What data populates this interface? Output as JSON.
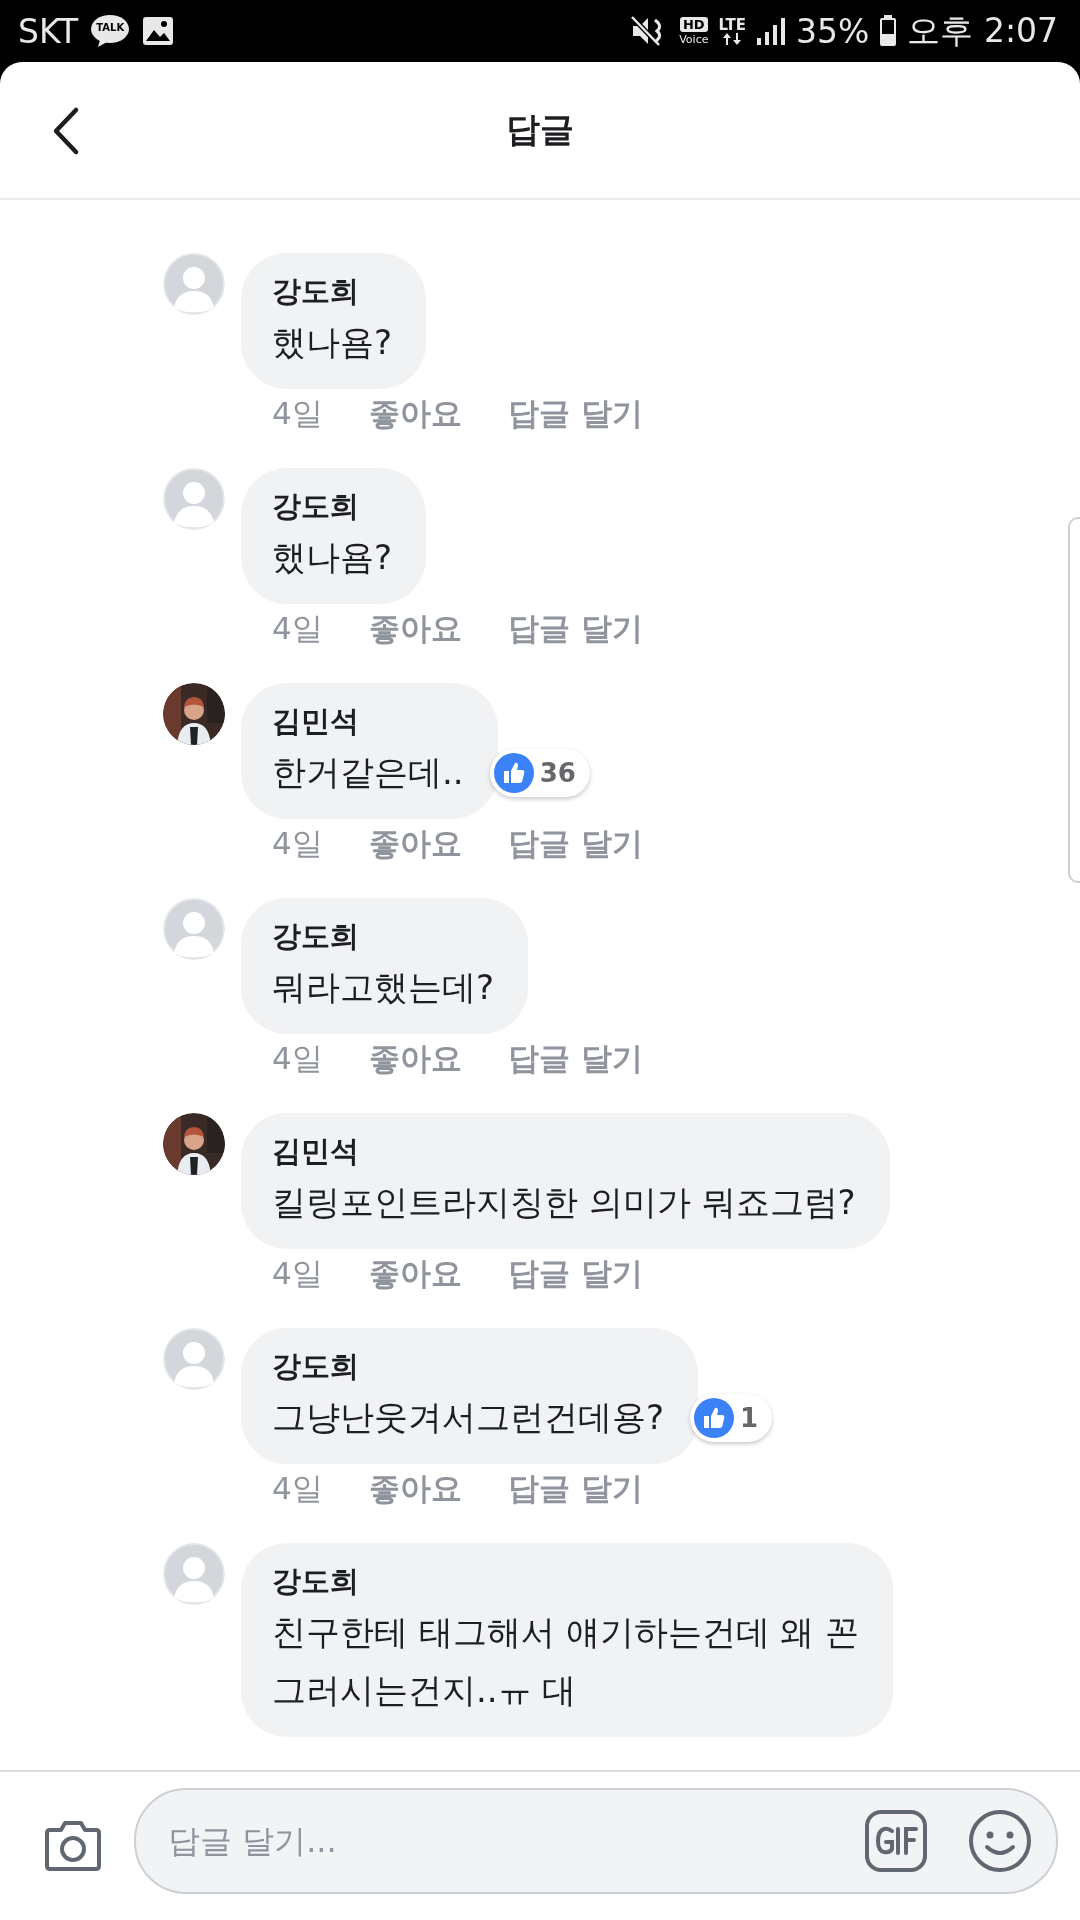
{
  "status_bar": {
    "carrier": "SKT",
    "talk_badge": "TALK",
    "hd_label": "HD",
    "voice_label": "Voice",
    "network": "LTE",
    "battery": "35%",
    "time": "오후 2:07"
  },
  "header": {
    "title": "답글"
  },
  "comments": [
    {
      "kind": "placeholder_avatar",
      "author": "강도희",
      "text": "했나욤?",
      "time": "4일",
      "like": "좋아요",
      "reply": "답글 달기"
    },
    {
      "kind": "placeholder_avatar",
      "author": "강도희",
      "text": "했나욤?",
      "time": "4일",
      "like": "좋아요",
      "reply": "답글 달기"
    },
    {
      "kind": "photo_avatar",
      "author": "김민석",
      "text": "한거같은데..",
      "time": "4일",
      "like": "좋아요",
      "reply": "답글 달기",
      "reaction": {
        "kind": "like",
        "count": "36"
      }
    },
    {
      "kind": "placeholder_avatar",
      "author": "강도희",
      "text": "뭐라고했는데?",
      "time": "4일",
      "like": "좋아요",
      "reply": "답글 달기"
    },
    {
      "kind": "photo_avatar",
      "author": "김민석",
      "text": "킬링포인트라지칭한 의미가 뭐죠그럼?",
      "time": "4일",
      "like": "좋아요",
      "reply": "답글 달기"
    },
    {
      "kind": "placeholder_avatar",
      "author": "강도희",
      "text": "그냥난웃겨서그런건데용?",
      "time": "4일",
      "like": "좋아요",
      "reply": "답글 달기",
      "reaction": {
        "kind": "like",
        "count": "1"
      }
    },
    {
      "kind": "placeholder_avatar",
      "author": "강도희",
      "text": "친구한테 태그해서 얘기하는건데 왜 꼰\n그러시는건지..ㅠ 대"
    }
  ],
  "input": {
    "placeholder": "답글 달기..."
  }
}
